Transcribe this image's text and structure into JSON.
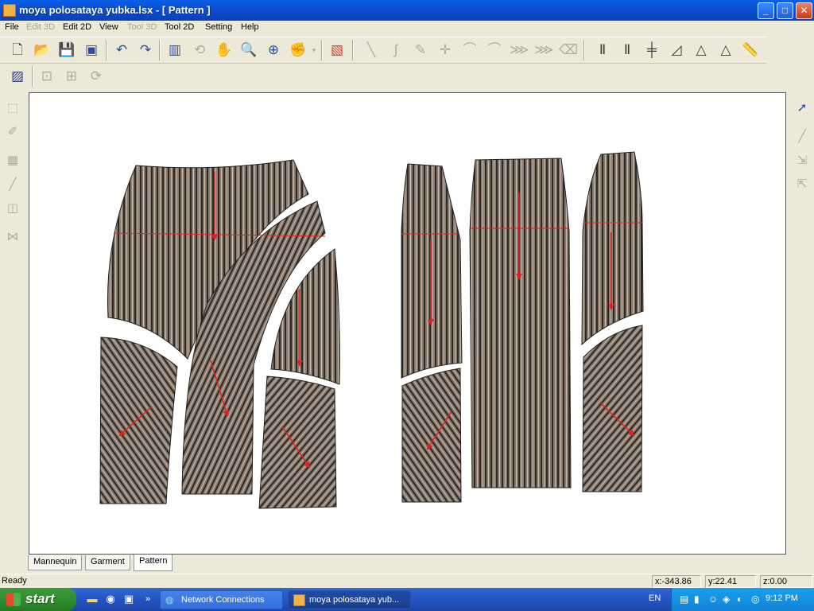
{
  "window": {
    "title": "moya polosataya yubka.lsx - [ Pattern  ]",
    "buttons": {
      "minimize": "_",
      "maximize": "□",
      "close": "✕"
    }
  },
  "menu": [
    {
      "label": "File",
      "enabled": true
    },
    {
      "label": "Edit 3D",
      "enabled": false
    },
    {
      "label": "Edit 2D",
      "enabled": true
    },
    {
      "label": "View",
      "enabled": true
    },
    {
      "label": "Tool 3D",
      "enabled": false
    },
    {
      "label": "Tool 2D",
      "enabled": true
    },
    {
      "label": "Setting",
      "enabled": true
    },
    {
      "label": "Help",
      "enabled": true
    }
  ],
  "toolbar": {
    "icons": [
      "new-file-icon",
      "open-folder-icon",
      "save-icon",
      "save-as-icon",
      "undo-icon",
      "redo-icon",
      "panel-icon",
      "rotate-icon",
      "pan-hand-icon",
      "zoom-icon",
      "zoom-fit-icon",
      "grab-icon",
      "dropdown-arrow-icon",
      "map-icon",
      "line-tool-icon",
      "curve-tool-icon",
      "pencil-icon",
      "point-tool-icon",
      "bezier-add-icon",
      "bezier-icon",
      "mirror-icon",
      "mirror-copy-icon",
      "eraser-icon",
      "seam-allowance-icon",
      "seam-line-icon",
      "notch-icon",
      "grading-icon",
      "triangle-rotate-icon",
      "triangle-flip-icon",
      "ruler-icon"
    ],
    "row2_icons": [
      "hatch-pattern-icon",
      "magnify-select-icon",
      "transform-icon",
      "reset-icon"
    ]
  },
  "left_tools": [
    "select-piece-icon",
    "pen-icon",
    "texture-icon",
    "knife-icon",
    "layer-icon",
    "fold-line-icon"
  ],
  "right_tools": [
    "arrow-pointer-icon",
    "draw-line-icon",
    "scale-x-icon",
    "scale-y-icon"
  ],
  "tabs": [
    {
      "label": "Mannequin",
      "active": false
    },
    {
      "label": "Garment",
      "active": false
    },
    {
      "label": "Pattern",
      "active": true
    }
  ],
  "status": {
    "text": "Ready",
    "x": "x:-343.86",
    "y": "y:22.41",
    "z": "z:0.00"
  },
  "taskbar": {
    "start_label": "start",
    "quicklaunch_more": "»",
    "windows": [
      {
        "label": "Network Connections",
        "active": false
      },
      {
        "label": "moya polosataya yub...",
        "active": true
      }
    ],
    "language": "EN",
    "clock": "9:12 PM"
  },
  "colors": {
    "fabric": "#8a7d70",
    "stripe_dark": "#2e2620",
    "stripe_light": "#c8b8b0",
    "grainline": "#e0201a",
    "canvas_bg": "#ffffff",
    "titlebar": "#0b4fd2"
  }
}
